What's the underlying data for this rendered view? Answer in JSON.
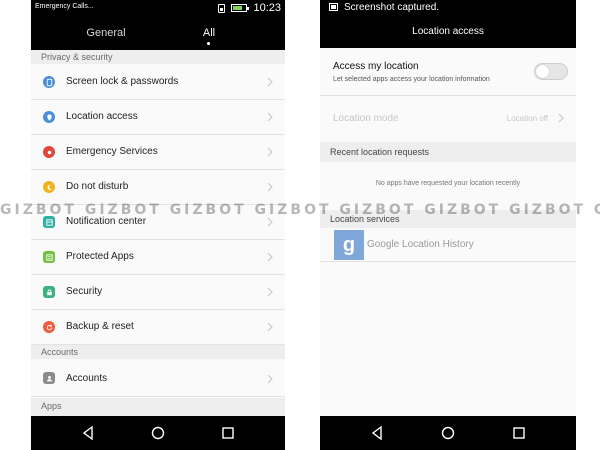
{
  "left": {
    "status": {
      "carrier": "Emergency Calls...",
      "time": "10:23"
    },
    "tabs": [
      {
        "label": "General"
      },
      {
        "label": "All"
      }
    ],
    "sections": {
      "privacy": "Privacy & security",
      "accounts": "Accounts",
      "apps": "Apps"
    },
    "items": [
      {
        "label": "Screen lock & passwords",
        "icon": "lock-screen-icon",
        "color": "#4a8fd6"
      },
      {
        "label": "Location access",
        "icon": "location-pin-icon",
        "color": "#4a8fd6"
      },
      {
        "label": "Emergency Services",
        "icon": "emergency-icon",
        "color": "#e0463b"
      },
      {
        "label": "Do not disturb",
        "icon": "moon-icon",
        "color": "#f2b21d"
      },
      {
        "label": "Notification center",
        "icon": "notification-icon",
        "color": "#2eb1a3"
      },
      {
        "label": "Protected Apps",
        "icon": "protected-apps-icon",
        "color": "#74c043"
      },
      {
        "label": "Security",
        "icon": "security-lock-icon",
        "color": "#3cb27c"
      },
      {
        "label": "Backup & reset",
        "icon": "backup-icon",
        "color": "#ef5b3c"
      },
      {
        "label": "Accounts",
        "icon": "accounts-icon",
        "color": "#8b8b8b"
      }
    ]
  },
  "right": {
    "status": {
      "notification": "Screenshot captured."
    },
    "title": "Location access",
    "access": {
      "title": "Access my location",
      "subtitle": "Let selected apps access your location information",
      "enabled": false
    },
    "mode": {
      "label": "Location mode",
      "value": "Location off"
    },
    "recent_header": "Recent location requests",
    "empty_message": "No apps have requested your location recently",
    "services_header": "Location services",
    "services": [
      {
        "label": "Google Location History",
        "icon_letter": "g"
      }
    ]
  },
  "watermark": "GIZBOT GIZBOT GIZBOT GIZBOT GIZBOT GIZBOT GIZBOT GIZBOT"
}
